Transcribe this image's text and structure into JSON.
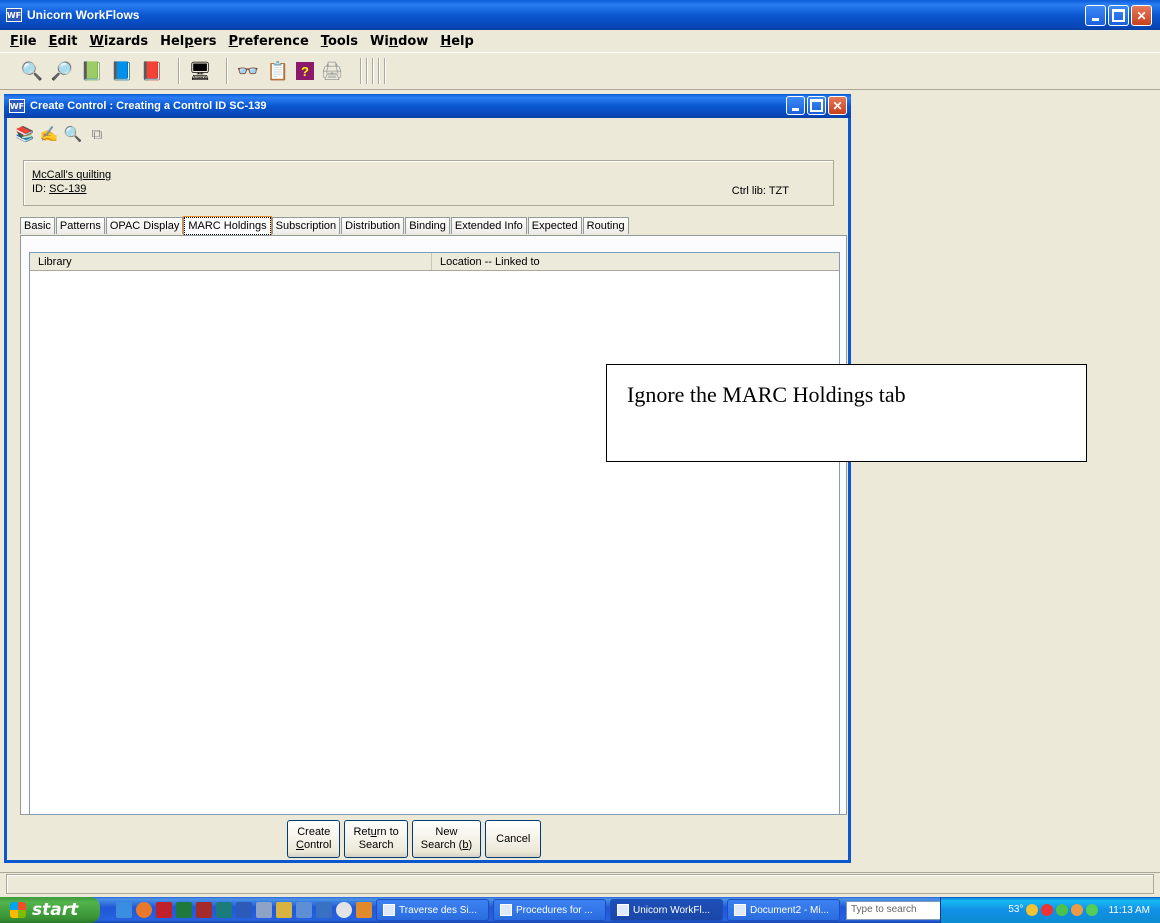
{
  "app": {
    "title": "Unicorn WorkFlows",
    "icon_text": "WF"
  },
  "menu": [
    {
      "label": "File",
      "u": "F",
      "rest": "ile"
    },
    {
      "label": "Edit",
      "u": "E",
      "rest": "dit"
    },
    {
      "label": "Wizards",
      "u": "W",
      "rest": "izards"
    },
    {
      "label": "Helpers",
      "pre": "Hel",
      "u": "p",
      "rest": "ers"
    },
    {
      "label": "Preference",
      "u": "P",
      "rest": "reference"
    },
    {
      "label": "Tools",
      "u": "T",
      "rest": "ools"
    },
    {
      "label": "Window",
      "pre": "Wi",
      "u": "n",
      "rest": "dow"
    },
    {
      "label": "Help",
      "u": "H",
      "rest": "elp"
    }
  ],
  "dialog": {
    "title": "Create Control : Creating a Control ID SC-139",
    "record_title": "McCall's quilting",
    "id_label": "ID: ",
    "id_value": "SC-139",
    "ctrl_lib": "Ctrl lib: TZT"
  },
  "tabs": [
    "Basic",
    "Patterns",
    "OPAC Display",
    "MARC Holdings",
    "Subscription",
    "Distribution",
    "Binding",
    "Extended Info",
    "Expected",
    "Routing"
  ],
  "active_tab": "MARC Holdings",
  "table": {
    "columns": [
      "Library",
      "Location -- Linked to"
    ]
  },
  "buttons": {
    "create": {
      "line1": "Create",
      "line2_u": "C",
      "line2_rest": "ontrol"
    },
    "return": {
      "line1_pre": "Ret",
      "line1_u": "u",
      "line1_rest": "rn to",
      "line2": "Search"
    },
    "new_search": {
      "line1": "New",
      "line2_pre": "Search (",
      "line2_u": "b",
      "line2_rest": ")"
    },
    "cancel": "Cancel"
  },
  "callout": "Ignore the MARC Holdings tab",
  "taskbar": {
    "start": "start",
    "tasks": [
      "Traverse des Si...",
      "Procedures for ...",
      "Unicorn WorkFl...",
      "Document2 - Mi..."
    ],
    "search_placeholder": "Type to search",
    "temperature": "53°",
    "clock": "11:13 AM"
  },
  "colors": {
    "title_blue": "#0a58d0",
    "face": "#ece9d8",
    "start_green": "#3a9336"
  }
}
